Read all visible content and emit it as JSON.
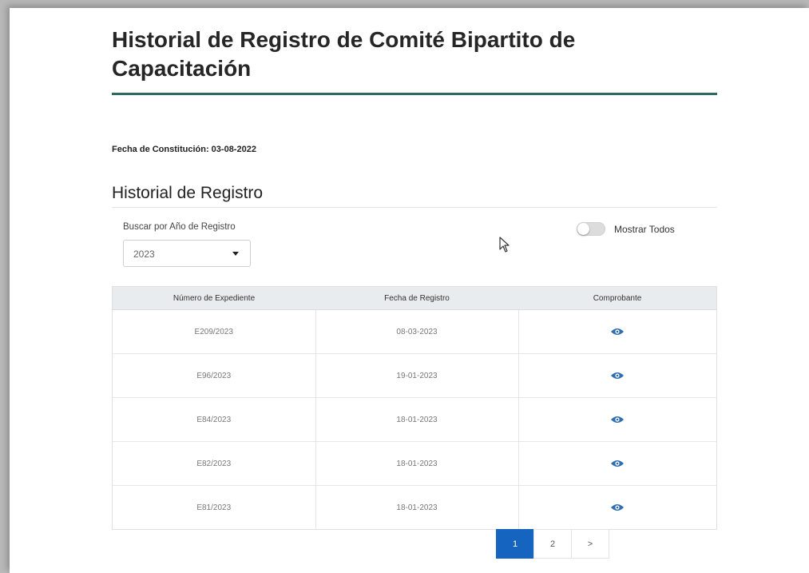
{
  "page": {
    "title": "Historial de Registro de Comité Bipartito de Capacitación",
    "fecha_constitucion": "Fecha de Constitución: 03-08-2022",
    "section_title": "Historial de Registro"
  },
  "filter": {
    "label": "Buscar por Año de Registro",
    "year_value": "2023",
    "toggle_label": "Mostrar Todos",
    "toggle_on": false
  },
  "table": {
    "headers": [
      "Número de Expediente",
      "Fecha de Registro",
      "Comprobante"
    ],
    "rows": [
      {
        "expediente": "E209/2023",
        "fecha": "08-03-2023",
        "comprobante_icon": "eye-icon"
      },
      {
        "expediente": "E96/2023",
        "fecha": "19-01-2023",
        "comprobante_icon": "eye-icon"
      },
      {
        "expediente": "E84/2023",
        "fecha": "18-01-2023",
        "comprobante_icon": "eye-icon"
      },
      {
        "expediente": "E82/2023",
        "fecha": "18-01-2023",
        "comprobante_icon": "eye-icon"
      },
      {
        "expediente": "E81/2023",
        "fecha": "18-01-2023",
        "comprobante_icon": "eye-icon"
      }
    ]
  },
  "pagination": {
    "pages": [
      "1",
      "2"
    ],
    "current": "1",
    "next_label": ">"
  },
  "colors": {
    "accent_rule": "#2e6b5f",
    "primary": "#1565c0",
    "eye_icon": "#2f6fb0",
    "header_bg": "#e9ecef"
  }
}
